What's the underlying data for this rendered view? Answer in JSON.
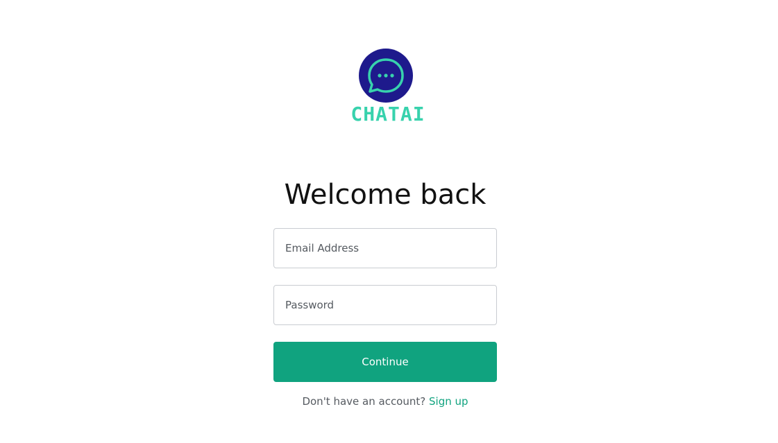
{
  "brand": {
    "name": "CHATAI",
    "logo_icon": "chat-bubble-dots-icon",
    "colors": {
      "circle": "#1e1a8c",
      "accent": "#38d2ad"
    }
  },
  "login": {
    "title": "Welcome back",
    "email_placeholder": "Email Address",
    "password_placeholder": "Password",
    "continue_label": "Continue",
    "signup_prompt": "Don't have an account?",
    "signup_link": "Sign up",
    "colors": {
      "primary": "#10a37f"
    }
  }
}
